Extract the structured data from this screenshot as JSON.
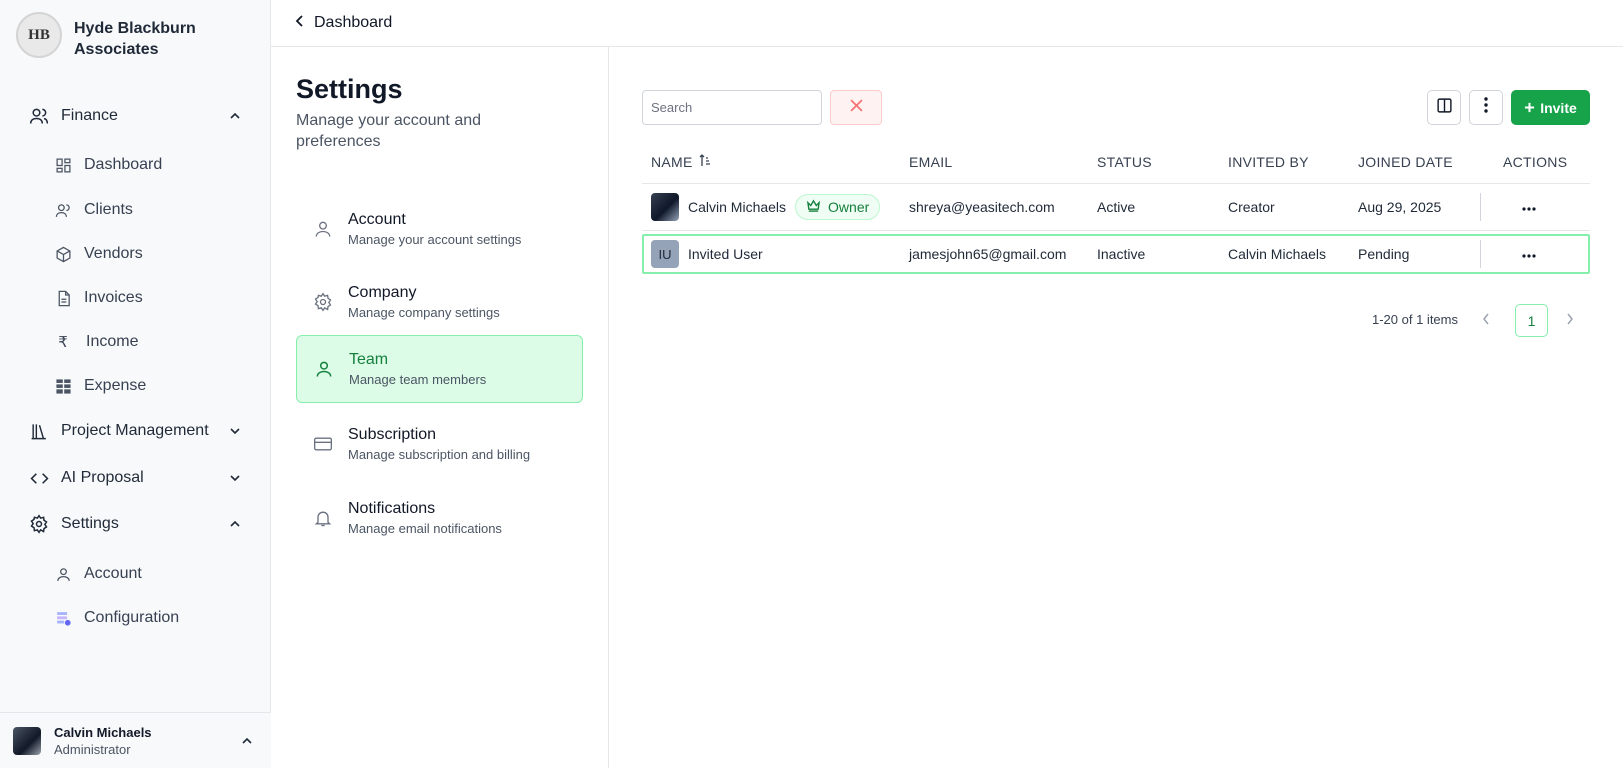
{
  "brand": {
    "name": "Hyde Blackburn Associates",
    "logo_text": "HB",
    "logo_icon": "firm-logo"
  },
  "sidebar": {
    "groups": [
      {
        "label": "Finance",
        "icon": "users-icon",
        "expanded": true
      },
      {
        "label": "Project Management",
        "icon": "library-icon",
        "expanded": false
      },
      {
        "label": "AI Proposal",
        "icon": "code-icon",
        "expanded": false
      },
      {
        "label": "Settings",
        "icon": "gear-icon",
        "expanded": true
      }
    ],
    "finance_items": [
      {
        "label": "Dashboard",
        "icon": "grid-icon"
      },
      {
        "label": "Clients",
        "icon": "users-icon"
      },
      {
        "label": "Vendors",
        "icon": "box-icon"
      },
      {
        "label": "Invoices",
        "icon": "document-icon"
      },
      {
        "label": "Income",
        "icon": "rupee-icon"
      },
      {
        "label": "Expense",
        "icon": "table-icon"
      }
    ],
    "settings_items": [
      {
        "label": "Account",
        "icon": "user-icon"
      },
      {
        "label": "Configuration",
        "icon": "config-icon"
      }
    ],
    "user": {
      "name": "Calvin Michaels",
      "role": "Administrator"
    }
  },
  "topbar": {
    "back_label": "Dashboard"
  },
  "settings": {
    "title": "Settings",
    "subtitle": "Manage your account and preferences",
    "menu": [
      {
        "title": "Account",
        "desc": "Manage your account settings",
        "icon": "user-icon",
        "active": false
      },
      {
        "title": "Company",
        "desc": "Manage company settings",
        "icon": "gear-icon",
        "active": false
      },
      {
        "title": "Team",
        "desc": "Manage team members",
        "icon": "user-icon",
        "active": true
      },
      {
        "title": "Subscription",
        "desc": "Manage subscription and billing",
        "icon": "card-icon",
        "active": false
      },
      {
        "title": "Notifications",
        "desc": "Manage email notifications",
        "icon": "bell-icon",
        "active": false
      }
    ]
  },
  "team": {
    "search_placeholder": "Search",
    "invite_label": "Invite",
    "columns": [
      "NAME",
      "EMAIL",
      "STATUS",
      "INVITED BY",
      "JOINED DATE",
      "ACTIONS"
    ],
    "rows": [
      {
        "name": "Calvin Michaels",
        "badge": "Owner",
        "avatar": "photo",
        "email": "shreya@yeasitech.com",
        "status": "Active",
        "invited_by": "Creator",
        "joined": "Aug 29, 2025",
        "selected": false
      },
      {
        "name": "Invited User",
        "initials": "IU",
        "avatar": "initials",
        "email": "jamesjohn65@gmail.com",
        "status": "Inactive",
        "invited_by": "Calvin Michaels",
        "joined": "Pending",
        "selected": true
      }
    ],
    "pagination": {
      "summary": "1-20 of 1 items",
      "current_page": "1"
    }
  },
  "colors": {
    "accent": "#16a34a",
    "active_bg": "#dcfce7",
    "danger_bg": "#fef2f2"
  }
}
